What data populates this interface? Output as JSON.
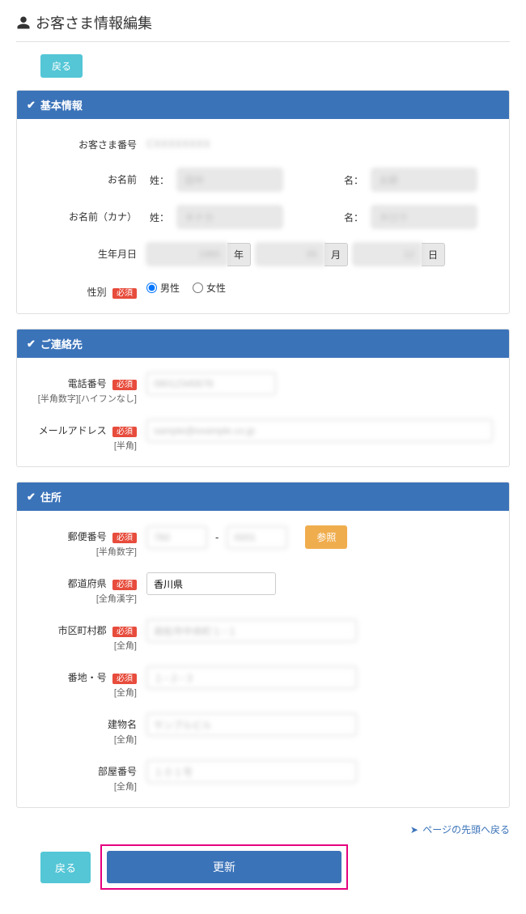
{
  "page": {
    "title": "お客さま情報編集"
  },
  "buttons": {
    "back": "戻る",
    "lookup": "参照",
    "update": "更新",
    "back2": "戻る",
    "topLink": "ページの先頭へ戻る"
  },
  "required_badge": "必須",
  "panels": {
    "basic": {
      "title": "基本情報"
    },
    "contact": {
      "title": "ご連絡先"
    },
    "address": {
      "title": "住所"
    }
  },
  "labels": {
    "customer_no": "お客さま番号",
    "name": "お名前",
    "name_kana": "お名前（カナ）",
    "sei": "姓：",
    "mei": "名：",
    "birthdate": "生年月日",
    "year": "年",
    "month": "月",
    "day": "日",
    "gender": "性別",
    "male": "男性",
    "female": "女性",
    "phone": "電話番号",
    "phone_hint": "[半角数字][ハイフンなし]",
    "email": "メールアドレス",
    "email_hint": "[半角]",
    "postal": "郵便番号",
    "postal_hint": "[半角数字]",
    "prefecture": "都道府県",
    "pref_hint": "[全角漢字]",
    "city": "市区町村郡",
    "city_hint": "[全角]",
    "street": "番地・号",
    "street_hint": "[全角]",
    "building": "建物名",
    "building_hint": "[全角]",
    "room": "部屋番号",
    "room_hint": "[全角]"
  },
  "values": {
    "customer_no": "CXXXXXXXX",
    "sei": "田中",
    "mei": "太郎",
    "sei_kana": "タナカ",
    "mei_kana": "タロウ",
    "year": "1985",
    "month": "05",
    "day": "12",
    "gender": "male",
    "phone": "08012345678",
    "email": "sample@example.co.jp",
    "postal1": "760",
    "postal2": "0001",
    "prefecture": "香川県",
    "city": "高松市中央町１−１",
    "street": "１−２−３",
    "building": "サンプルビル",
    "room": "１０１号"
  }
}
